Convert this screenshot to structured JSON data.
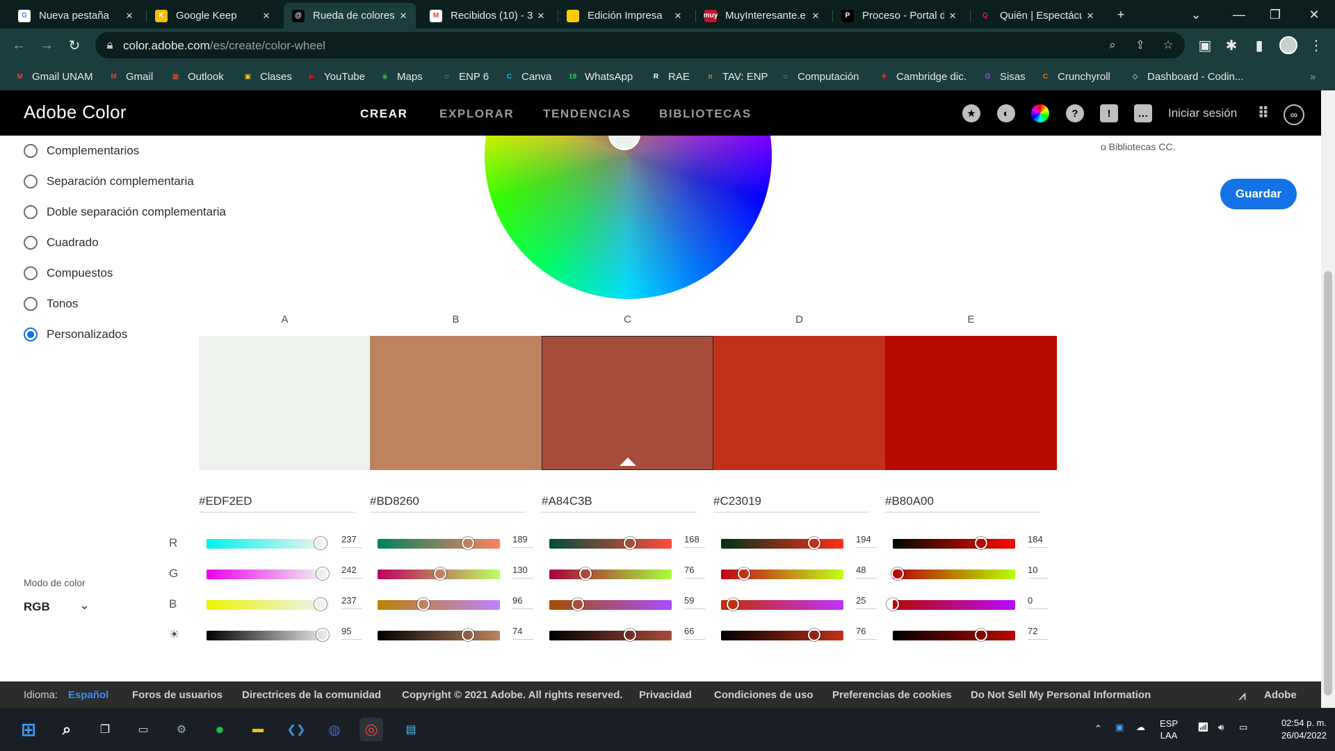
{
  "browser": {
    "tabs": [
      {
        "title": "Nueva pestaña",
        "fav": "G",
        "color": "#ffffff",
        "fg": "#4285f4"
      },
      {
        "title": "Google Keep",
        "fav": "K",
        "color": "#fbbc04",
        "fg": "#ffffff"
      },
      {
        "title": "Rueda de colores",
        "fav": "@",
        "color": "#000000",
        "fg": "#ffffff"
      },
      {
        "title": "Recibidos (10) - 3",
        "fav": "M",
        "color": "#ffffff",
        "fg": "#ea4335"
      },
      {
        "title": "Edición Impresa",
        "fav": "",
        "color": "#ffcc00",
        "fg": "#ffffff"
      },
      {
        "title": "MuyInteresante.e",
        "fav": "muy",
        "color": "#c4122f",
        "fg": "#ffffff"
      },
      {
        "title": "Proceso - Portal d",
        "fav": "P",
        "color": "#000000",
        "fg": "#ffffff"
      },
      {
        "title": "Quién | Espectácu",
        "fav": "Q",
        "color": "#0b1f1f",
        "fg": "#e91e63"
      }
    ],
    "new_tab_icon": "plus-icon",
    "url_domain": "color.adobe.com",
    "url_path": "/es/create/color-wheel",
    "bookmarks": [
      {
        "label": "Gmail UNAM",
        "icon": "M",
        "color": "#ea4335"
      },
      {
        "label": "Gmail",
        "icon": "M",
        "color": "#ea4335"
      },
      {
        "label": "Outlook",
        "icon": "▦",
        "color": "#f25022"
      },
      {
        "label": "Clases",
        "icon": "▣",
        "color": "#fbc02d"
      },
      {
        "label": "YouTube",
        "icon": "▶",
        "color": "#ff0000"
      },
      {
        "label": "Maps",
        "icon": "◉",
        "color": "#34a853"
      },
      {
        "label": "ENP 6",
        "icon": "◌",
        "color": "#ffffff"
      },
      {
        "label": "Canva",
        "icon": "C",
        "color": "#00c4cc"
      },
      {
        "label": "WhatsApp",
        "icon": "19",
        "color": "#25d366"
      },
      {
        "label": "RAE",
        "icon": "R",
        "color": "#ffffff"
      },
      {
        "label": "TAV: ENP",
        "icon": "n",
        "color": "#f57c00"
      },
      {
        "label": "Computación",
        "icon": "◌",
        "color": "#ffffff"
      },
      {
        "label": "Cambridge dic.",
        "icon": "✚",
        "color": "#d32f2f"
      },
      {
        "label": "Sisas",
        "icon": "✪",
        "color": "#7e57c2"
      },
      {
        "label": "Crunchyroll",
        "icon": "C",
        "color": "#f47521"
      },
      {
        "label": "Dashboard - Codin...",
        "icon": "◇",
        "color": "#ffffff"
      }
    ]
  },
  "adobe": {
    "brand": "Adobe Color",
    "nav": [
      "CREAR",
      "EXPLORAR",
      "TENDENCIAS",
      "BIBLIOTECAS"
    ],
    "signin": "Iniciar sesión",
    "save": "Guardar",
    "lib_note": "o Bibliotecas CC."
  },
  "harmony": {
    "options": [
      "Complementarios",
      "Separación complementaria",
      "Doble separación complementaria",
      "Cuadrado",
      "Compuestos",
      "Tonos",
      "Personalizados"
    ],
    "selected": "Personalizados"
  },
  "palette": [
    {
      "label": "A",
      "hex": "#EDF2ED",
      "r": 237,
      "g": 242,
      "b": 237,
      "br": 95
    },
    {
      "label": "B",
      "hex": "#BD8260",
      "r": 189,
      "g": 130,
      "b": 96,
      "br": 74
    },
    {
      "label": "C",
      "hex": "#A84C3B",
      "r": 168,
      "g": 76,
      "b": 59,
      "br": 66
    },
    {
      "label": "D",
      "hex": "#C23019",
      "r": 194,
      "g": 48,
      "b": 25,
      "br": 76
    },
    {
      "label": "E",
      "hex": "#B80A00",
      "r": 184,
      "g": 10,
      "b": 0,
      "br": 72
    }
  ],
  "selected_swatch": "C",
  "rows": [
    "R",
    "G",
    "B",
    "☀"
  ],
  "color_mode": {
    "label": "Modo de color",
    "value": "RGB"
  },
  "footer": {
    "lang_label": "Idioma:",
    "lang_value": "Español",
    "links": [
      "Foros de usuarios",
      "Directrices de la comunidad",
      "Copyright © 2021 Adobe. All rights reserved.",
      "Privacidad",
      "Condiciones de uso",
      "Preferencias de cookies",
      "Do Not Sell My Personal Information"
    ],
    "adobe": "Adobe"
  },
  "taskbar": {
    "lang": "ESP",
    "lang2": "LAA",
    "time": "02:54 p. m.",
    "date": "26/04/2022"
  }
}
